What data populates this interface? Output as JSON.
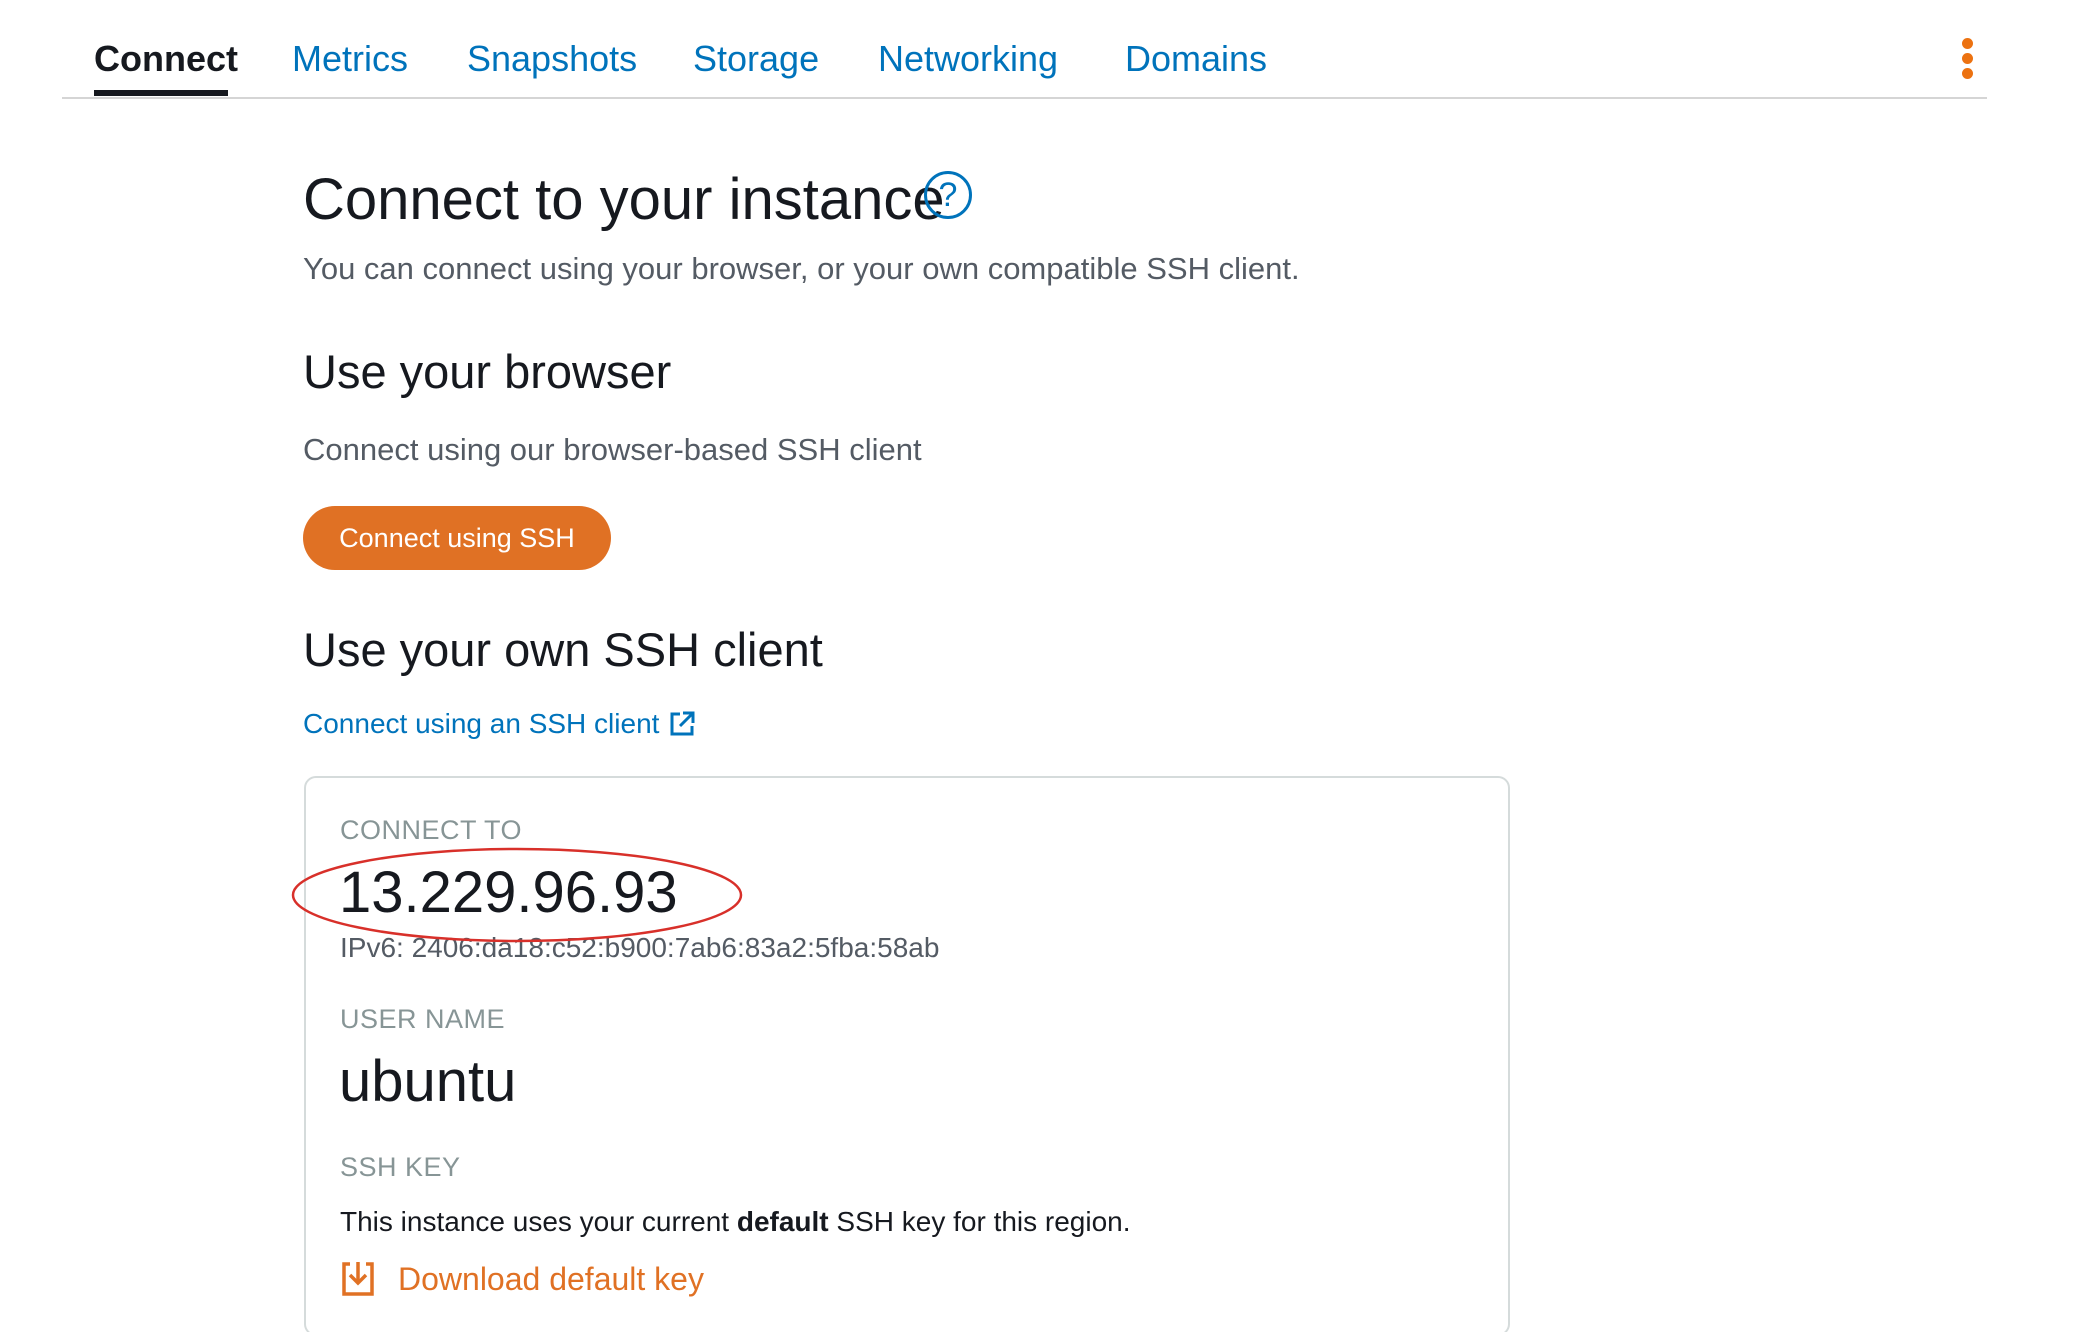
{
  "tabs": [
    {
      "label": "Connect",
      "active": true
    },
    {
      "label": "Metrics"
    },
    {
      "label": "Snapshots"
    },
    {
      "label": "Storage"
    },
    {
      "label": "Networking"
    },
    {
      "label": "Domains"
    }
  ],
  "page": {
    "title": "Connect to your instance",
    "help_icon": "?",
    "subtitle": "You can connect using your browser, or your own compatible SSH client."
  },
  "browser_section": {
    "heading": "Use your browser",
    "description": "Connect using our browser-based SSH client",
    "button_label": "Connect using SSH"
  },
  "own_client_section": {
    "heading": "Use your own SSH client",
    "link_label": "Connect using an SSH client"
  },
  "connect_card": {
    "connect_to_label": "CONNECT TO",
    "ip_address": "13.229.96.93",
    "ipv6": "IPv6: 2406:da18:c52:b900:7ab6:83a2:5fba:58ab",
    "user_name_label": "USER NAME",
    "user_name": "ubuntu",
    "ssh_key_label": "SSH KEY",
    "key_text_before": "This instance uses your current ",
    "key_text_bold": "default",
    "key_text_after": " SSH key for this region.",
    "download_label": "Download default key"
  },
  "icons": {
    "more_options": "kebab-vertical-icon",
    "help": "question-circle-icon",
    "external_link": "external-link-icon",
    "download": "download-icon"
  },
  "colors": {
    "link_blue": "#0073bb",
    "accent_orange": "#e07124",
    "highlight_red": "#d8302a",
    "text_dark": "#16191f",
    "text_muted": "#545b64"
  }
}
